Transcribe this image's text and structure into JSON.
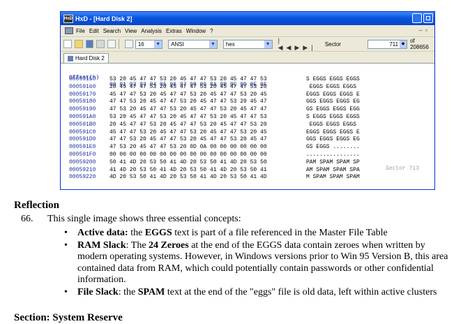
{
  "window": {
    "title": "HxD - [Hard Disk 2]",
    "app_icon_text": "HxD",
    "menu": [
      "File",
      "Edit",
      "Search",
      "View",
      "Analysis",
      "Extras",
      "Window",
      "?"
    ]
  },
  "toolbar": {
    "bytes_per_row": "16",
    "charset": "ANSI",
    "offset_base": "hex",
    "sector_label": "Sector",
    "sector_value": "711",
    "sector_total": "of 208656"
  },
  "tab": {
    "label": "Hard Disk 2"
  },
  "hex_header": {
    "offset": "Offset(h)",
    "columns": "00 01 02 03 04 05 06 07 08 09 0A 0B 0C 0D 0E 0F"
  },
  "hex_rows": [
    {
      "offset": "00059150",
      "hex": "53 20 45 47 47 53 20 45 47 47 53 20 45 47 47 53",
      "ascii": "S EGGS EGGS EGGS"
    },
    {
      "offset": "00059160",
      "hex": "20 45 47 47 53 20 45 47 47 53 20 45 47 47 53 20",
      "ascii": " EGGS EGGS EGGS "
    },
    {
      "offset": "00059170",
      "hex": "45 47 47 53 20 45 47 47 53 20 45 47 47 53 20 45",
      "ascii": "EGGS EGGS EGGS E"
    },
    {
      "offset": "00059180",
      "hex": "47 47 53 20 45 47 47 53 20 45 47 47 53 20 45 47",
      "ascii": "GGS EGGS EGGS EG"
    },
    {
      "offset": "00059190",
      "hex": "47 53 20 45 47 47 53 20 45 47 47 53 20 45 47 47",
      "ascii": "GS EGGS EGGS EGG"
    },
    {
      "offset": "000591A0",
      "hex": "53 20 45 47 47 53 20 45 47 47 53 20 45 47 47 53",
      "ascii": "S EGGS EGGS EGGS"
    },
    {
      "offset": "000591B0",
      "hex": "20 45 47 47 53 20 45 47 47 53 20 45 47 47 53 20",
      "ascii": " EGGS EGGS EGGS "
    },
    {
      "offset": "000591C0",
      "hex": "45 47 47 53 20 45 47 47 53 20 45 47 47 53 20 45",
      "ascii": "EGGS EGGS EGGS E"
    },
    {
      "offset": "000591D0",
      "hex": "47 47 53 20 45 47 47 53 20 45 47 47 53 20 45 47",
      "ascii": "GGS EGGS EGGS EG"
    },
    {
      "offset": "000591E0",
      "hex": "47 53 20 45 47 47 53 20 0D 0A 00 00 00 00 00 00",
      "ascii": "GS EGGS ........"
    },
    {
      "offset": "000591F0",
      "hex": "00 00 00 00 00 00 00 00 00 00 00 00 00 00 00 00",
      "ascii": "................"
    },
    {
      "offset": "00059200",
      "hex": "50 41 4D 20 53 50 41 4D 20 53 50 41 4D 20 53 50",
      "ascii": "PAM SPAM SPAM SP"
    },
    {
      "offset": "00059210",
      "hex": "41 4D 20 53 50 41 4D 20 53 50 41 4D 20 53 50 41",
      "ascii": "AM SPAM SPAM SPA"
    },
    {
      "offset": "00059220",
      "hex": "4D 20 53 50 41 4D 20 53 50 41 4D 20 53 50 41 4D",
      "ascii": "M SPAM SPAM SPAM"
    }
  ],
  "sector_marker": "Sector 713",
  "doc": {
    "heading": "Reflection",
    "para_num": "66.",
    "para_text": "This single image shows three essential concepts:",
    "bullets": [
      {
        "bold_a": "Active data:",
        "text_a": " the ",
        "bold_b": "EGGS",
        "text_b": " text is part of a file referenced in the Master File Table"
      },
      {
        "bold_a": "RAM Slack",
        "text_a": ": The ",
        "bold_b": "24 Zeroes",
        "text_b": " at the end of the EGGS data contain zeroes when written by modern operating systems.  However, in Windows versions prior to Win 95 Version B, this area contained data from RAM, which could potentially contain passwords or other confidential information."
      },
      {
        "bold_a": "File Slack",
        "text_a": ": the ",
        "bold_b": "SPAM",
        "text_b": " text at the end of the \"eggs\" file is old data, left within active clusters"
      }
    ],
    "next_heading": "Section: System Reserve"
  }
}
